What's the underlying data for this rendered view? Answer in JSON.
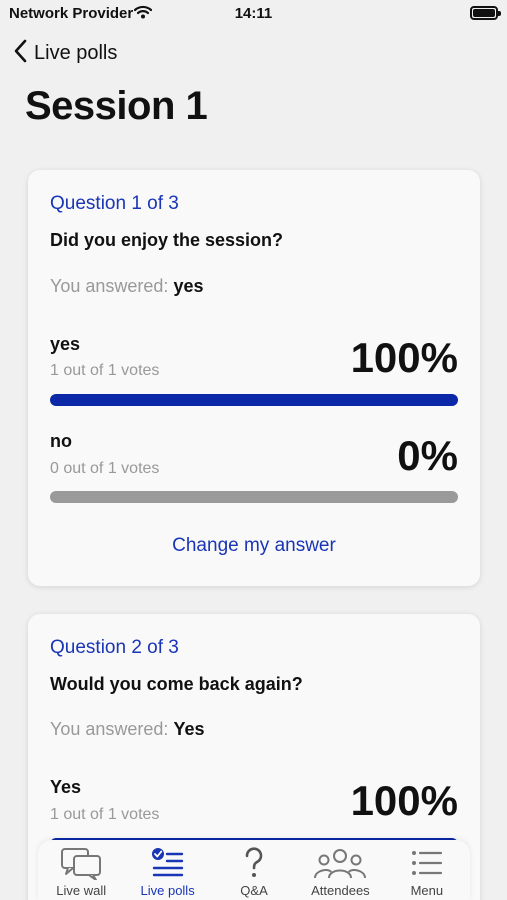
{
  "status_bar": {
    "carrier": "Network Provider",
    "time": "14:11"
  },
  "nav": {
    "back_label": "Live polls"
  },
  "page": {
    "title": "Session 1"
  },
  "polls": [
    {
      "number": "Question 1 of 3",
      "question": "Did you enjoy the session?",
      "answered_prefix": "You answered:",
      "answered_value": "yes",
      "options": [
        {
          "label": "yes",
          "votes": "1 out of 1 votes",
          "percent": "100%",
          "fraction": 1.0
        },
        {
          "label": "no",
          "votes": "0 out of 1 votes",
          "percent": "0%",
          "fraction": 0.0
        }
      ],
      "change_label": "Change my answer"
    },
    {
      "number": "Question 2 of 3",
      "question": "Would you come back again?",
      "answered_prefix": "You answered:",
      "answered_value": "Yes",
      "options": [
        {
          "label": "Yes",
          "votes": "1 out of 1 votes",
          "percent": "100%",
          "fraction": 1.0
        }
      ]
    }
  ],
  "tabs": [
    {
      "label": "Live wall",
      "icon": "chat-bubbles-icon",
      "active": false
    },
    {
      "label": "Live polls",
      "icon": "poll-list-icon",
      "active": true
    },
    {
      "label": "Q&A",
      "icon": "question-mark-icon",
      "active": false
    },
    {
      "label": "Attendees",
      "icon": "people-icon",
      "active": false
    },
    {
      "label": "Menu",
      "icon": "menu-list-icon",
      "active": false
    }
  ],
  "colors": {
    "accent": "#1a35b5",
    "bar_fill": "#0a28a8",
    "bar_track": "#9a9a9a",
    "background": "#f0f0f0",
    "card": "#f9f9f9"
  }
}
